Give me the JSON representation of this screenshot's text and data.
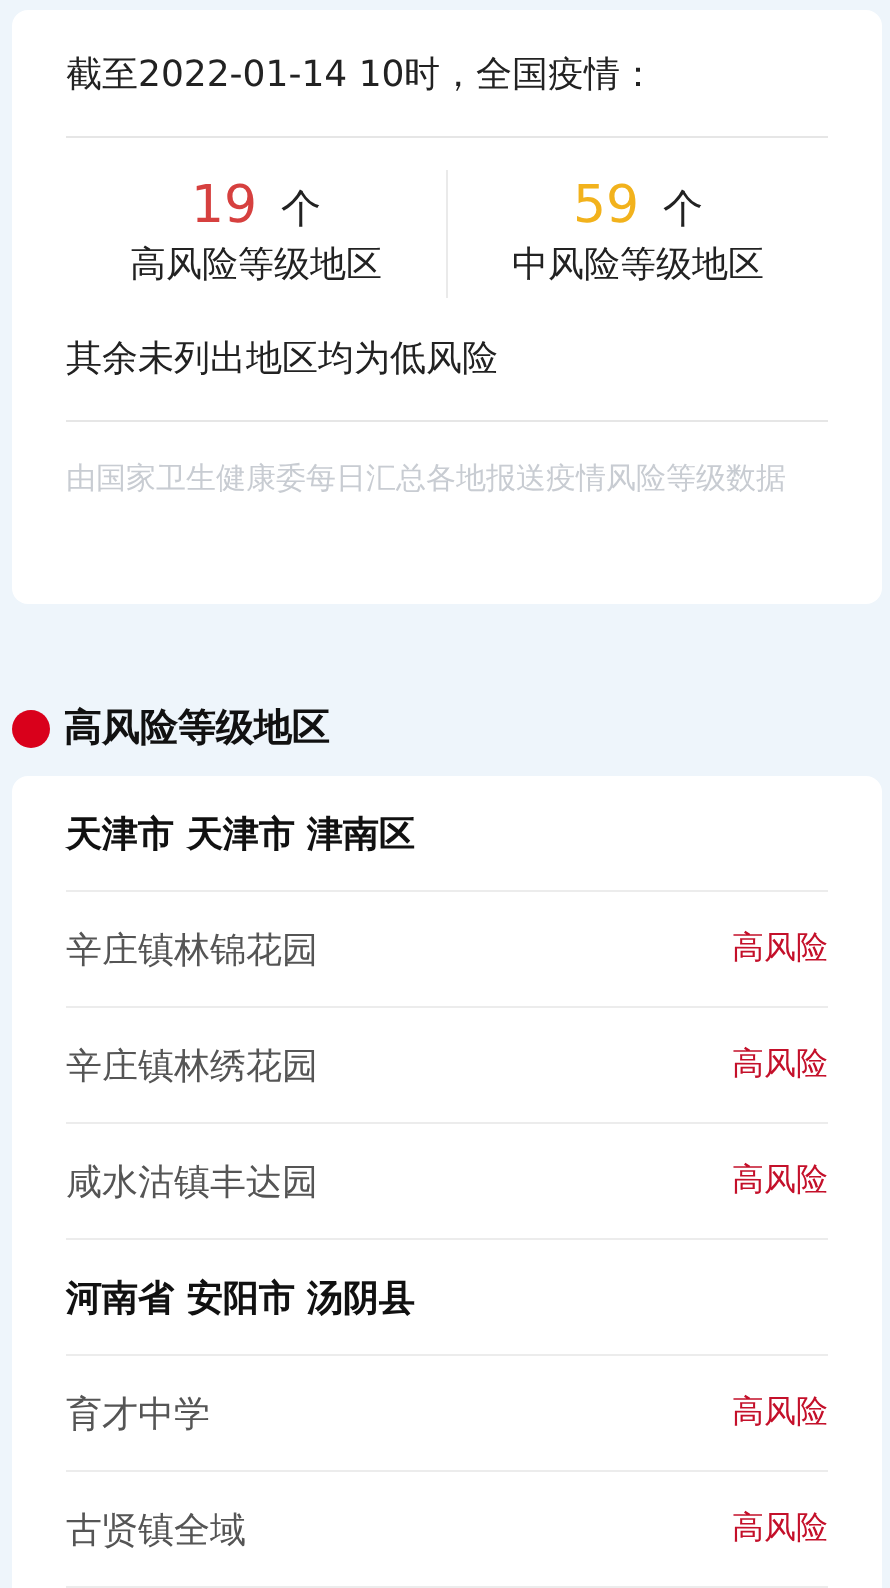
{
  "summary": {
    "title": "截至2022-01-14 10时，全国疫情：",
    "stats": [
      {
        "kind": "high",
        "count": "19",
        "unit": "个",
        "label": "高风险等级地区"
      },
      {
        "kind": "medium",
        "count": "59",
        "unit": "个",
        "label": "中风险等级地区"
      }
    ],
    "remark": "其余未列出地区均为低风险",
    "source": "由国家卫生健康委每日汇总各地报送疫情风险等级数据"
  },
  "section": {
    "title": "高风险等级地区",
    "groups": [
      {
        "region": "天津市 天津市 津南区",
        "areas": [
          {
            "name": "辛庄镇林锦花园",
            "risk": "高风险"
          },
          {
            "name": "辛庄镇林绣花园",
            "risk": "高风险"
          },
          {
            "name": "咸水沽镇丰达园",
            "risk": "高风险"
          }
        ]
      },
      {
        "region": "河南省 安阳市 汤阴县",
        "areas": [
          {
            "name": "育才中学",
            "risk": "高风险"
          },
          {
            "name": "古贤镇全域",
            "risk": "高风险"
          }
        ]
      }
    ]
  }
}
